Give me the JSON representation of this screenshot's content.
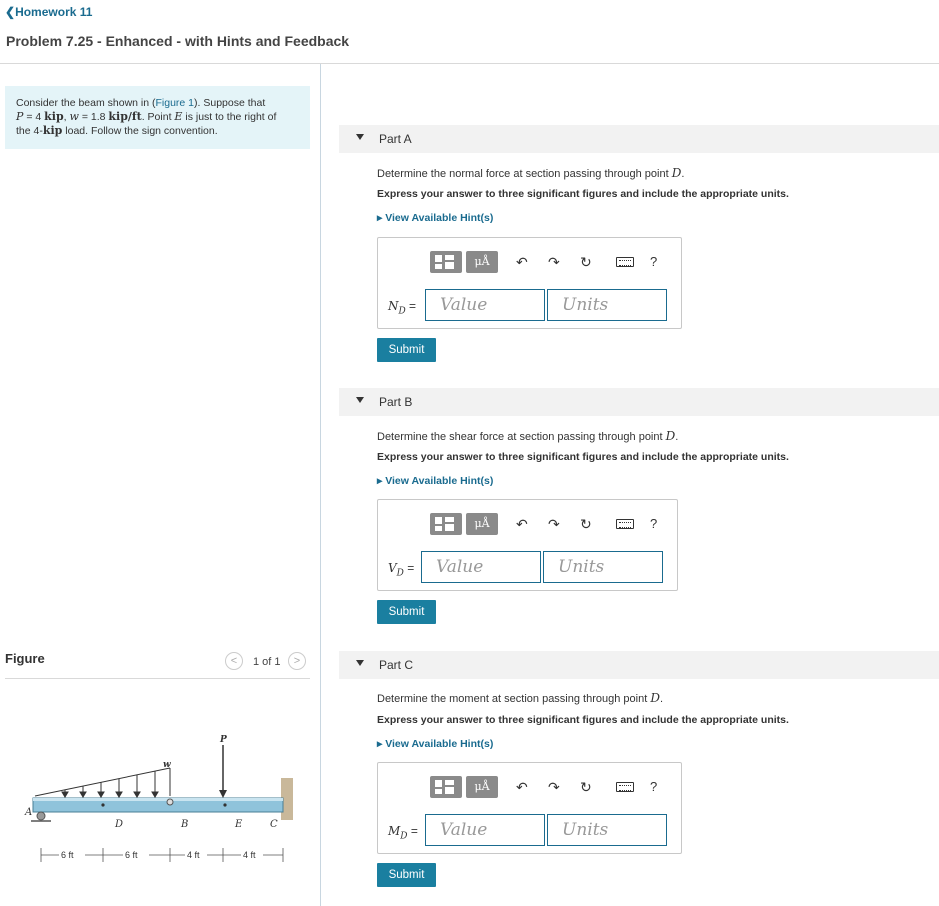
{
  "nav": {
    "back_label": "Homework 11"
  },
  "problem": {
    "title": "Problem 7.25 - Enhanced - with Hints and Feedback",
    "intro_prefix": "Consider the beam shown in (",
    "figure_link": "Figure 1",
    "intro_after_link": "). Suppose that",
    "P_var": "P",
    "P_eq": " = 4 ",
    "P_unit": "kip",
    "w_var": "w",
    "w_eq": " = 1.8 ",
    "w_unit": "kip/ft",
    "point_text_prefix": ". Point ",
    "point_var": "E",
    "point_text_suffix": " is just to the right of",
    "line3_prefix": "the 4-",
    "line3_bold": "kip",
    "line3_suffix": " load. Follow the sign convention."
  },
  "figure_panel": {
    "label": "Figure",
    "pager": "1 of 1",
    "prev_glyph": "<",
    "next_glyph": ">",
    "labels": {
      "A": "A",
      "B": "B",
      "C": "C",
      "D": "D",
      "E": "E",
      "P": "P",
      "w": "w",
      "dim1": "6 ft",
      "dim2": "6 ft",
      "dim3": "4 ft",
      "dim4": "4 ft"
    }
  },
  "toolbar": {
    "mu_label": "μÅ",
    "undo_icon": "undo-icon",
    "redo_icon": "redo-icon",
    "reset_icon": "reset-icon",
    "keyboard_icon": "keyboard-icon",
    "help_label": "?"
  },
  "parts": [
    {
      "title": "Part A",
      "question_prefix": "Determine the normal force at section passing through point ",
      "question_var": "D",
      "question_suffix": ".",
      "instruction": "Express your answer to three significant figures and include the appropriate units.",
      "hint_label": "View Available Hint(s)",
      "answer_var": "N",
      "answer_sub": "D",
      "answer_eq": " =",
      "value_placeholder": "Value",
      "units_placeholder": "Units",
      "submit_label": "Submit"
    },
    {
      "title": "Part B",
      "question_prefix": "Determine the shear force at section passing through point ",
      "question_var": "D",
      "question_suffix": ".",
      "instruction": "Express your answer to three significant figures and include the appropriate units.",
      "hint_label": "View Available Hint(s)",
      "answer_var": "V",
      "answer_sub": "D",
      "answer_eq": " =",
      "value_placeholder": "Value",
      "units_placeholder": "Units",
      "submit_label": "Submit"
    },
    {
      "title": "Part C",
      "question_prefix": "Determine the moment at section passing through point ",
      "question_var": "D",
      "question_suffix": ".",
      "instruction": "Express your answer to three significant figures and include the appropriate units.",
      "hint_label": "View Available Hint(s)",
      "answer_var": "M",
      "answer_sub": "D",
      "answer_eq": " =",
      "value_placeholder": "Value",
      "units_placeholder": "Units",
      "submit_label": "Submit"
    }
  ]
}
